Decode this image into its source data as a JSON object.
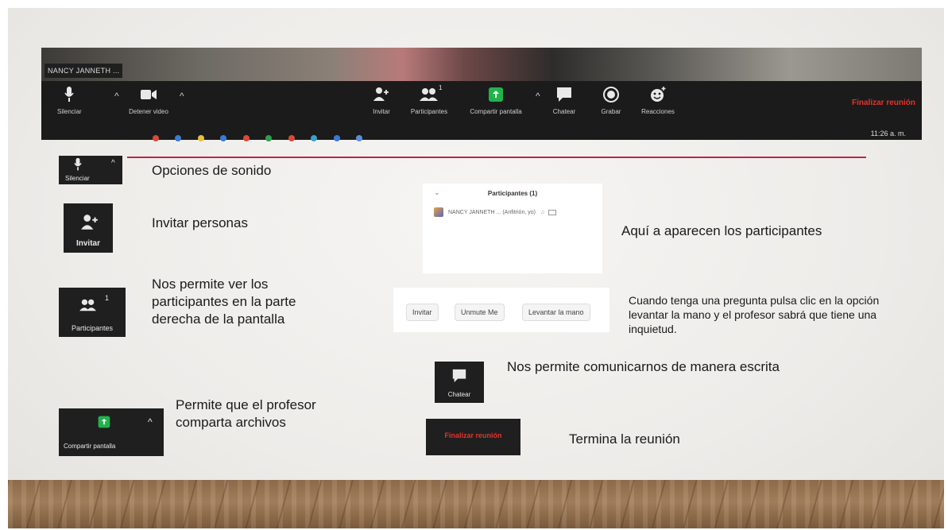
{
  "zoom_bar": {
    "name_tag": "NANCY JANNETH ...",
    "items": [
      "Silenciar",
      "Detener video",
      "Invitar",
      "Participantes",
      "Compartir pantalla",
      "Chatear",
      "Grabar",
      "Reacciones"
    ],
    "participants_count": "1",
    "end_label": "Finalizar reunión",
    "clock": "11:26 a. m."
  },
  "tiles": {
    "mute": "Silenciar",
    "invite": "Invitar",
    "participants": "Participantes",
    "participants_count": "1",
    "share": "Compartir pantalla",
    "chat": "Chatear",
    "end": "Finalizar reunión"
  },
  "descriptions": {
    "sound": "Opciones de sonido",
    "invite": "Invitar personas",
    "participants": "Nos permite ver los participantes en la parte derecha de la pantalla",
    "share": "Permite que el profesor comparta archivos",
    "panel": "Aquí a aparecen los participantes",
    "raise_hand": "Cuando tenga una pregunta pulsa clic en la opción levantar la mano y el profesor sabrá que tiene una inquietud.",
    "chat": "Nos permite comunicarnos de manera escrita",
    "end": "Termina la reunión"
  },
  "panel": {
    "title": "Participantes (1)",
    "row": "NANCY JANNETH ... (Anfitrión, yo)"
  },
  "panel_buttons": [
    "Invitar",
    "Unmute Me",
    "Levantar la mano"
  ],
  "colors": {
    "accent_rule": "#b5294a",
    "end_red": "#e5322d",
    "share_green": "#22b24c"
  }
}
